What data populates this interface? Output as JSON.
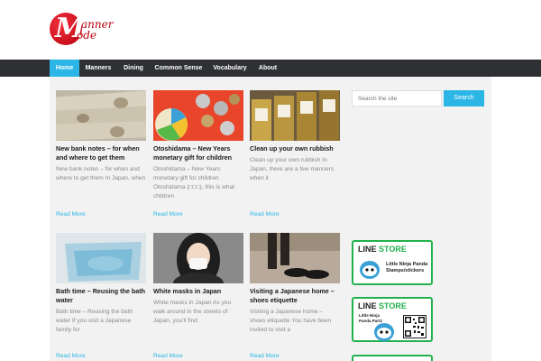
{
  "site": {
    "logo_initial": "M",
    "logo_word1": "anner",
    "logo_word2": "ode"
  },
  "nav": {
    "items": [
      {
        "label": "Home",
        "active": true
      },
      {
        "label": "Manners",
        "active": false
      },
      {
        "label": "Dining",
        "active": false
      },
      {
        "label": "Common Sense",
        "active": false
      },
      {
        "label": "Vocabulary",
        "active": false
      },
      {
        "label": "About",
        "active": false
      }
    ]
  },
  "search": {
    "placeholder": "Search the site",
    "button_label": "Search"
  },
  "posts": [
    {
      "title": "New bank notes – for when and where to get them",
      "excerpt": "New bank notes – for when and where to get them In Japan, when",
      "read_more": "Read More",
      "image": "yen-banknotes"
    },
    {
      "title": "Otoshidama – New Years monetary gift for children",
      "excerpt": "Otoshidama – New Years monetary gift for children Otoshidama (□□□), this is what children",
      "read_more": "Read More",
      "image": "coins-on-board"
    },
    {
      "title": "Clean up your own rubbish",
      "excerpt": "Clean up your own rubbish In Japan, there are a few manners when it",
      "read_more": "Read More",
      "image": "recycling-bins"
    },
    {
      "title": "Bath time – Reusing the bath water",
      "excerpt": "Bath time – Reusing the bath water If you visit a Japanese family for",
      "read_more": "Read More",
      "image": "bathtub"
    },
    {
      "title": "White masks in Japan",
      "excerpt": "White masks in Japan As you walk around in the streets of Japan, you'll find",
      "read_more": "Read More",
      "image": "woman-mask"
    },
    {
      "title": "Visiting a Japanese home – shoes etiquette",
      "excerpt": "Visiting a Japanese home – shoes etiquette You have been invited to visit a",
      "read_more": "Read More",
      "image": "shoes-genkan"
    }
  ],
  "sidebar_ads": [
    {
      "title_line": "LINE",
      "title_store": "STORE",
      "subtitle": "Little Ninja Panda Stamps/stickers",
      "has_qr": false
    },
    {
      "title_line": "LINE",
      "title_store": "STORE",
      "subtitle": "Little Ninja Panda Part2",
      "has_qr": true
    }
  ],
  "colors": {
    "accent": "#2bb6e6",
    "nav_bg": "#2e3033",
    "logo_red": "#c8101c",
    "line_green": "#22b14c"
  }
}
